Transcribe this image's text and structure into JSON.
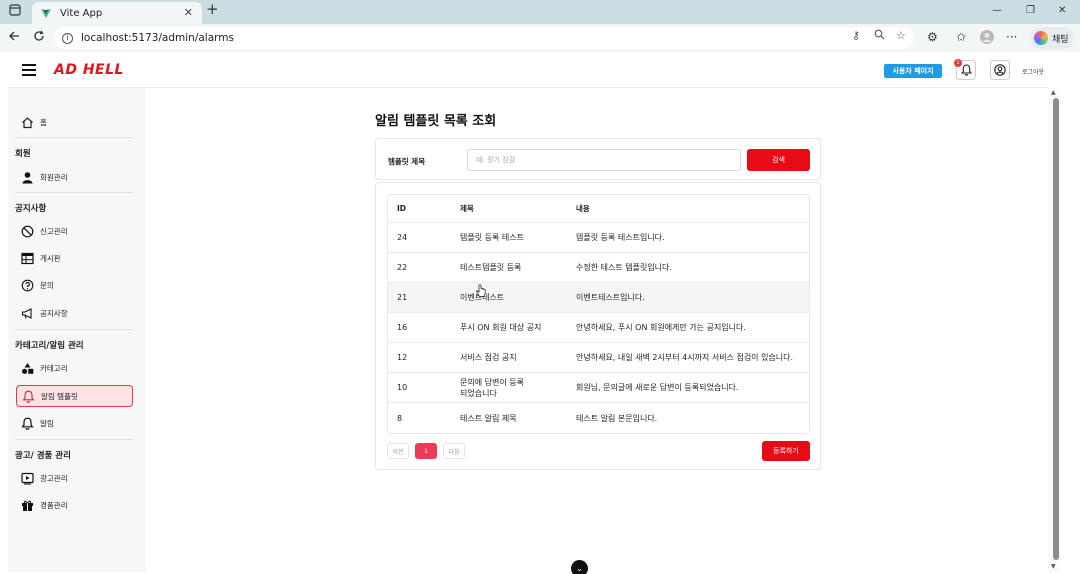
{
  "browser": {
    "tab_title": "Vite App",
    "tab_close": "✕",
    "new_tab": "+",
    "url": "localhost:5173/admin/alarms",
    "copilot_label": "채팅",
    "window_controls": [
      "—",
      "❐",
      "✕"
    ]
  },
  "header": {
    "logo": "AD HELL",
    "user_page_button": "사용자 페이지",
    "notification_count": "1",
    "logout": "로그아웃"
  },
  "sidebar": {
    "home": "홈",
    "sections": [
      {
        "title": "회원",
        "items": [
          "회원관리"
        ]
      },
      {
        "title": "공지사항",
        "items": [
          "신고관리",
          "게시판",
          "문의",
          "공지사항"
        ]
      },
      {
        "title": "카테고리/알림 관리",
        "items": [
          "카테고리",
          "알림 템플릿",
          "알림"
        ]
      },
      {
        "title": "광고/ 경품 관리",
        "items": [
          "광고관리",
          "경품관리"
        ]
      }
    ],
    "active_item": "알림 템플릿"
  },
  "page": {
    "title": "알림 템플릿 목록 조회",
    "search": {
      "label": "템플릿 제목",
      "placeholder": "예: 정기 점검",
      "button": "검색"
    },
    "table": {
      "columns": [
        "ID",
        "제목",
        "내용"
      ],
      "rows": [
        {
          "id": "24",
          "title": "템플릿 등록 테스트",
          "content": "템플릿 등록 테스트입니다."
        },
        {
          "id": "22",
          "title": "테스트템플릿 등록",
          "content": "수정한 테스트 템플릿입니다."
        },
        {
          "id": "21",
          "title": "이벤트테스트",
          "content": "이벤트테스트입니다."
        },
        {
          "id": "16",
          "title": "푸시 ON 회원 대상 공지",
          "content": "안녕하세요, 푸시 ON 회원에게만 가는 공지입니다."
        },
        {
          "id": "12",
          "title": "서비스 점검 공지",
          "content": "안녕하세요, 내일 새벽 2시부터 4시까지 서비스 점검이 있습니다."
        },
        {
          "id": "10",
          "title": "문의에 답변이 등록되었습니다",
          "content": "회원님, 문의글에 새로운 답변이 등록되었습니다."
        },
        {
          "id": "8",
          "title": "테스트 알림 제목",
          "content": "테스트 알림 본문입니다."
        }
      ]
    },
    "pagination": {
      "prev": "이전",
      "current": "1",
      "next": "다음"
    },
    "register_button": "등록하기"
  },
  "icons": {
    "home": "home-icon",
    "members": "person-icon",
    "reports": "ban-icon",
    "board": "table-icon",
    "inquiry": "question-icon",
    "notice": "megaphone-icon",
    "category": "shapes-icon",
    "template": "bell-icon",
    "alarm": "bell-icon",
    "ads": "play-box-icon",
    "prizes": "gift-icon"
  },
  "colors": {
    "brand_red": "#e80b16",
    "active_bg": "#fde3e6",
    "active_border": "#e33b4e",
    "user_page_blue": "#1e9be6"
  }
}
